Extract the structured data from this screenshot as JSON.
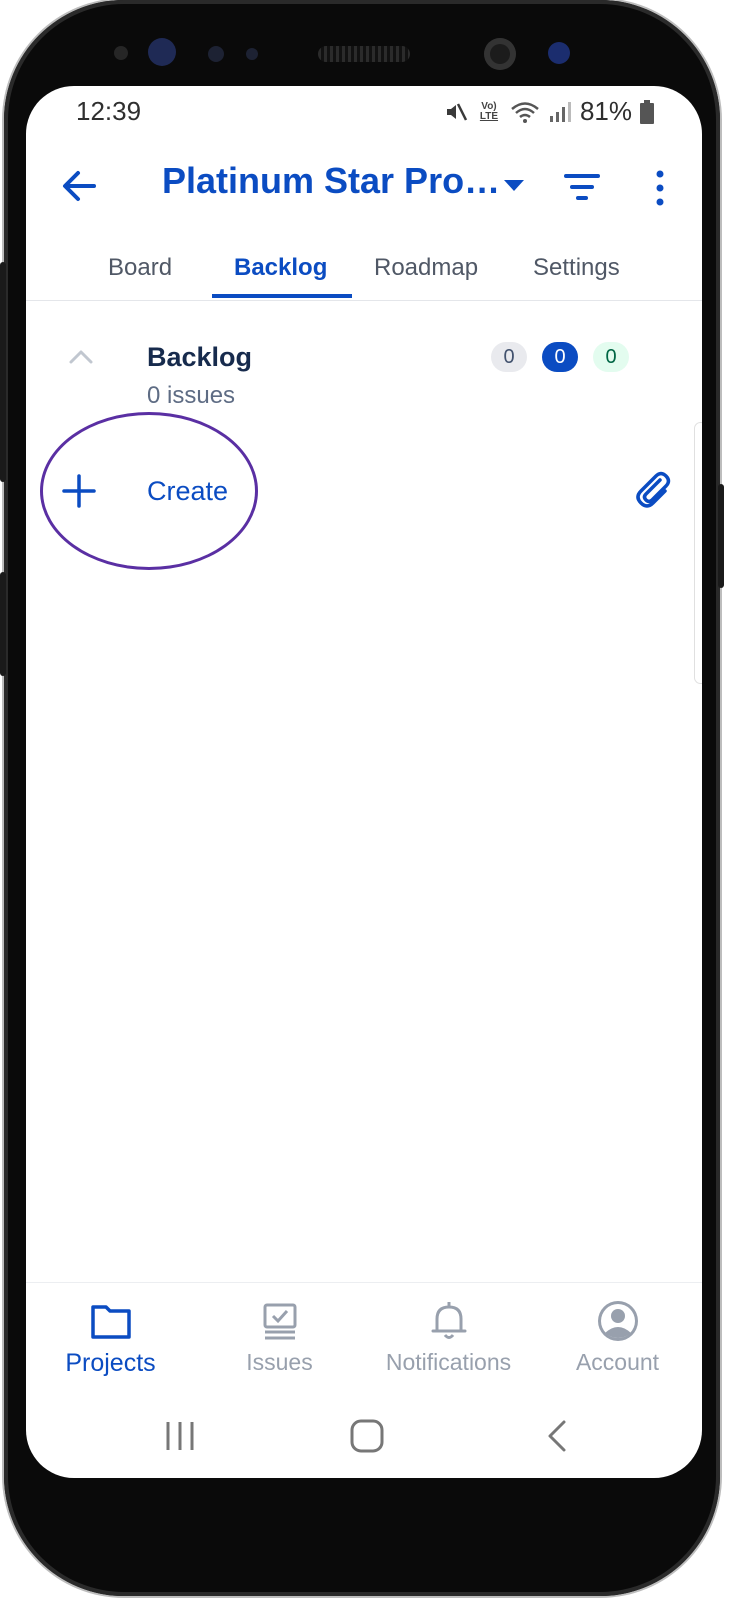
{
  "status_bar": {
    "time": "12:39",
    "volte": "Vo)",
    "lte": "LTE",
    "battery": "81%",
    "icons": [
      "mute-icon",
      "volte-icon",
      "wifi-icon",
      "signal-icon",
      "battery-icon"
    ]
  },
  "app_bar": {
    "title": "Platinum Star Pro…",
    "icons": [
      "back-arrow-icon",
      "dropdown-caret-icon",
      "filter-icon",
      "more-vertical-icon"
    ]
  },
  "tabs": [
    {
      "label": "Board",
      "active": false
    },
    {
      "label": "Backlog",
      "active": true
    },
    {
      "label": "Roadmap",
      "active": false
    },
    {
      "label": "Settings",
      "active": false
    }
  ],
  "backlog": {
    "title": "Backlog",
    "issues_label": "0 issues",
    "badges": {
      "todo": "0",
      "in_progress": "0",
      "done": "0"
    }
  },
  "create": {
    "label": "Create",
    "icons": [
      "plus-icon",
      "attachment-icon"
    ]
  },
  "bottom_nav": [
    {
      "label": "Projects",
      "icon": "folder-icon",
      "active": true
    },
    {
      "label": "Issues",
      "icon": "issues-icon",
      "active": false
    },
    {
      "label": "Notifications",
      "icon": "bell-icon",
      "active": false
    },
    {
      "label": "Account",
      "icon": "account-icon",
      "active": false
    }
  ],
  "colors": {
    "accent": "#0b4cc2",
    "text_dark": "#172b4d",
    "muted": "#5e6c84",
    "annotation_ring": "#5a2fa3"
  }
}
